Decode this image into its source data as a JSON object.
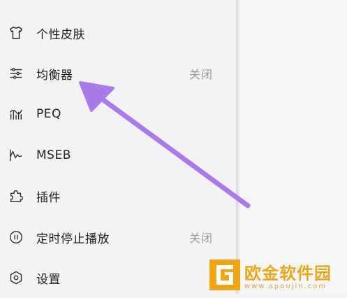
{
  "menu": {
    "items": [
      {
        "label": "个性皮肤",
        "value": "",
        "icon": "tshirt-icon"
      },
      {
        "label": "均衡器",
        "value": "关闭",
        "icon": "equalizer-sliders-icon"
      },
      {
        "label": "PEQ",
        "value": "",
        "icon": "peq-bars-icon"
      },
      {
        "label": "MSEB",
        "value": "",
        "icon": "mseb-waveform-icon"
      },
      {
        "label": "插件",
        "value": "",
        "icon": "puzzle-piece-icon"
      },
      {
        "label": "定时停止播放",
        "value": "关闭",
        "icon": "pause-timer-icon"
      },
      {
        "label": "设置",
        "value": "",
        "icon": "gear-icon"
      }
    ]
  },
  "annotation": {
    "color": "#a97bea"
  },
  "watermark": {
    "title": "欧金软件园",
    "url": "www.apoujin.com",
    "color": "#f0a517"
  }
}
